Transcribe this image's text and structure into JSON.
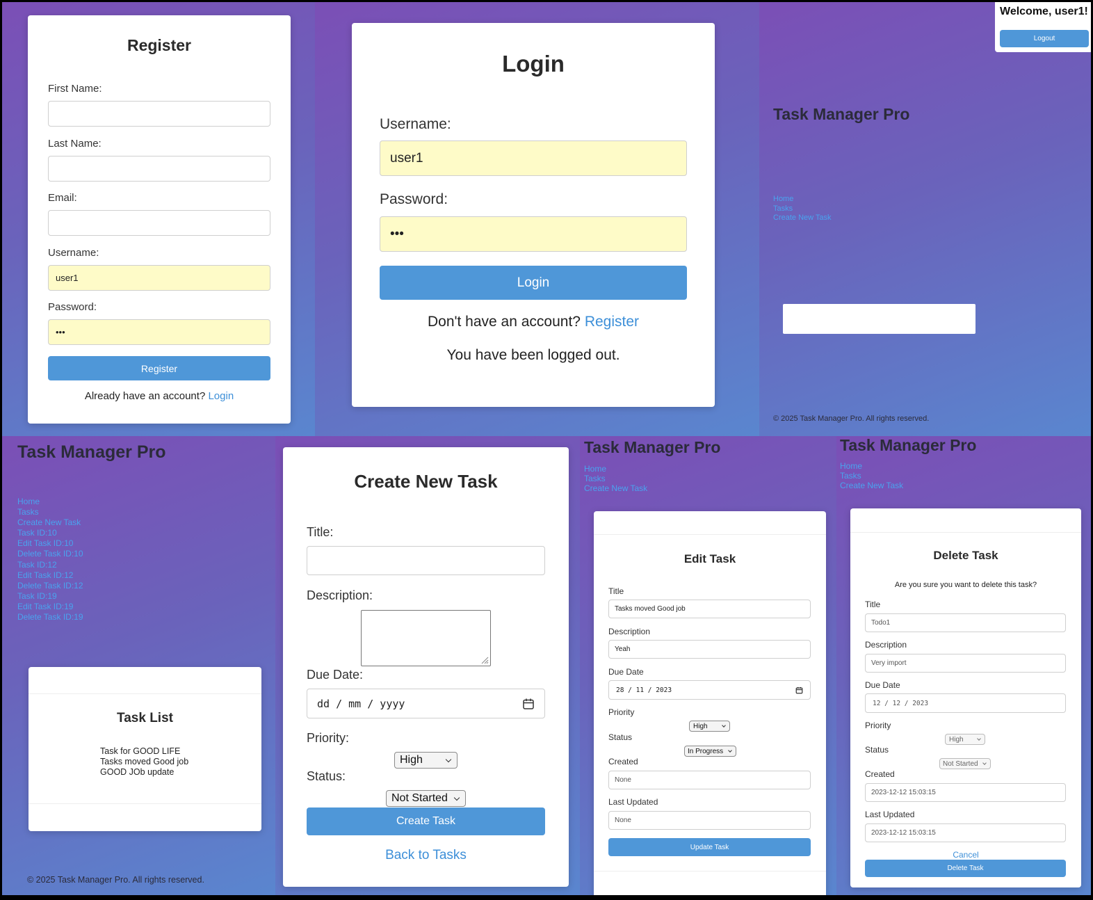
{
  "register": {
    "title": "Register",
    "first_name_label": "First Name:",
    "last_name_label": "Last Name:",
    "email_label": "Email:",
    "username_label": "Username:",
    "username_value": "user1",
    "password_label": "Password:",
    "password_value": "•••",
    "submit_label": "Register",
    "prompt": "Already have an account?",
    "login_link": "Login"
  },
  "login": {
    "title": "Login",
    "username_label": "Username:",
    "username_value": "user1",
    "password_label": "Password:",
    "password_value": "•••",
    "submit_label": "Login",
    "prompt": "Don't have an account?",
    "register_link": "Register",
    "message": "You have been logged out."
  },
  "home": {
    "welcome": "Welcome, user1!",
    "logout_label": "Logout",
    "brand": "Task Manager Pro",
    "nav": [
      "Home",
      "Tasks",
      "Create New Task"
    ],
    "footer": "© 2025 Task Manager Pro. All rights reserved."
  },
  "tasks_page": {
    "brand": "Task Manager Pro",
    "nav": [
      "Home",
      "Tasks",
      "Create New Task",
      "Task ID:10",
      "Edit Task ID:10",
      "Delete Task ID:10",
      "Task ID:12",
      "Edit Task ID:12",
      "Delete Task ID:12",
      "Task ID:19",
      "Edit Task ID:19",
      "Delete Task ID:19"
    ],
    "list_title": "Task List",
    "tasks": [
      "Task for GOOD LIFE",
      "Tasks moved Good job",
      "GOOD JOb update"
    ],
    "footer": "© 2025 Task Manager Pro. All rights reserved."
  },
  "create_task": {
    "title": "Create New Task",
    "title_label": "Title:",
    "description_label": "Description:",
    "due_date_label": "Due Date:",
    "due_date_placeholder": "dd / mm / yyyy",
    "priority_label": "Priority:",
    "priority_value": "High",
    "status_label": "Status:",
    "status_value": "Not Started",
    "submit_label": "Create Task",
    "back_link": "Back to Tasks"
  },
  "edit_task": {
    "brand": "Task Manager Pro",
    "nav": [
      "Home",
      "Tasks",
      "Create New Task"
    ],
    "heading": "Edit Task",
    "title_label": "Title",
    "title_value": "Tasks moved Good job",
    "description_label": "Description",
    "description_value": "Yeah",
    "due_date_label": "Due Date",
    "due_date_value": "28 / 11 / 2023",
    "priority_label": "Priority",
    "priority_value": "High",
    "status_label": "Status",
    "status_value": "In Progress",
    "created_label": "Created",
    "created_value": "None",
    "updated_label": "Last Updated",
    "updated_value": "None",
    "submit_label": "Update Task"
  },
  "delete_task": {
    "brand": "Task Manager Pro",
    "nav": [
      "Home",
      "Tasks",
      "Create New Task"
    ],
    "heading": "Delete Task",
    "confirm": "Are you sure you want to delete this task?",
    "title_label": "Title",
    "title_value": "Todo1",
    "description_label": "Description",
    "description_value": "Very import",
    "due_date_label": "Due Date",
    "due_date_value": "12 / 12 / 2023",
    "priority_label": "Priority",
    "priority_value": "High",
    "status_label": "Status",
    "status_value": "Not Started",
    "created_label": "Created",
    "created_value": "2023-12-12 15:03:15",
    "updated_label": "Last Updated",
    "updated_value": "2023-12-12 15:03:15",
    "cancel_link": "Cancel",
    "submit_label": "Delete Task"
  },
  "colors": {
    "accent": "#4f97d8",
    "link": "#3d8fd8",
    "nav_link": "#4aa3ef",
    "autofill": "#fefbc8"
  },
  "icons": [
    "calendar-icon",
    "chevron-down-icon"
  ]
}
